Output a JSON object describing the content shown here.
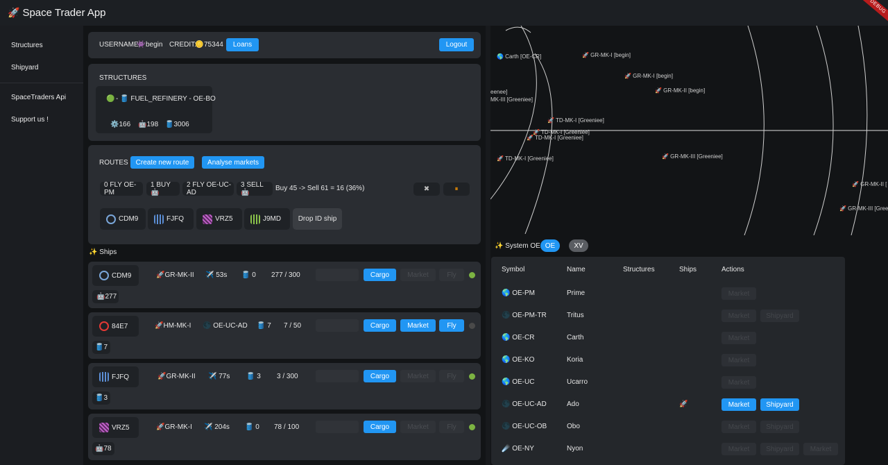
{
  "app": {
    "title": "Space Trader App",
    "debug": "DEBUG"
  },
  "sidebar": {
    "items": [
      "Structures",
      "Shipyard",
      "SpaceTraders Api",
      "Support us !"
    ]
  },
  "header": {
    "username_label": "USERNAME:",
    "username_icon": "👾",
    "username": "begin",
    "credit_label": "CREDIT:",
    "credit_icon": "🪙",
    "credit": "75344",
    "loans": "Loans",
    "logout": "Logout"
  },
  "structures": {
    "title": "STRUCTURES",
    "item": {
      "status": "🟢",
      "name": "- 🛢️ FUEL_REFINERY - OE-BO",
      "stats": [
        "⚙️166",
        "🤖198",
        "🛢️3006"
      ]
    }
  },
  "routes": {
    "title": "ROUTES",
    "create": "Create new route",
    "analyse": "Analyse markets",
    "steps": [
      "0 FLY OE-PM",
      "1 BUY 🤖",
      "2 FLY OE-UC-AD",
      "3 SELL 🤖"
    ],
    "summary": "Buy 45 -> Sell 61 = 16 (36%)",
    "close_icon": "✖",
    "pause_icon": "⏸",
    "ships": [
      "CDM9",
      "FJFQ",
      "VRZ5",
      "J9MD"
    ],
    "drop": "Drop ID ship"
  },
  "ships_section": {
    "title": "✨ Ships"
  },
  "ships": [
    {
      "id": "CDM9",
      "model": "🚀GR-MK-II",
      "status": "✈️ 53s",
      "fuel": "🛢️ 0",
      "cargo": "277 / 300",
      "extra": "🤖277",
      "btns": [
        "Cargo"
      ],
      "dim": [
        "",
        "Market",
        "Fly"
      ],
      "dot": "#7cb342"
    },
    {
      "id": "84E7",
      "model": "🚀HM-MK-I",
      "status": "🌑 OE-UC-AD",
      "fuel": "🛢️ 7",
      "cargo": "7 / 50",
      "extra": "🛢️7",
      "btns": [
        "Cargo",
        "Market",
        "Fly"
      ],
      "dim": [
        ""
      ],
      "dot": "#4a4a4a"
    },
    {
      "id": "FJFQ",
      "model": "🚀GR-MK-II",
      "status": "✈️ 77s",
      "fuel": "🛢️ 3",
      "cargo": "3 / 300",
      "extra": "🛢️3",
      "btns": [
        "Cargo"
      ],
      "dim": [
        "",
        "Market",
        "Fly"
      ],
      "dot": "#7cb342"
    },
    {
      "id": "VRZ5",
      "model": "🚀GR-MK-I",
      "status": "✈️ 204s",
      "fuel": "🛢️ 0",
      "cargo": "78 / 100",
      "extra": "🤖78",
      "btns": [
        "Cargo"
      ],
      "dim": [
        "",
        "Market",
        "Fly"
      ],
      "dot": "#7cb342"
    }
  ],
  "map": {
    "labels": [
      "🌎 Carth [OE-CR]",
      "🚀 GR-MK-I [begin]",
      "🚀 GR-MK-I [begin]",
      "🚀 GR-MK-II [begin]",
      "eenee]",
      "MK-III [Greeniee]",
      "🚀 TD-MK-I [Greeniee]",
      "🚀 TD-MK-I [Greeniee]",
      "🚀 TD-MK-I [Greeniee]",
      "🚀 TD-MK-I [Greeniee]",
      "🚀 GR-MK-III [Greeniee]",
      "🚀 GR-MK-II [",
      "🚀 GR-MK-III [Gree"
    ]
  },
  "system": {
    "title": "✨ System OE",
    "tabs": [
      "OE",
      "XV"
    ],
    "columns": [
      "Symbol",
      "Name",
      "Structures",
      "Ships",
      "Actions"
    ],
    "rows": [
      {
        "symbol": "🌎 OE-PM",
        "name": "Prime",
        "ships": "",
        "actions": [
          {
            "label": "Market",
            "on": false
          }
        ]
      },
      {
        "symbol": "🌑 OE-PM-TR",
        "name": "Tritus",
        "ships": "",
        "actions": [
          {
            "label": "Market",
            "on": false
          },
          {
            "label": "Shipyard",
            "on": false
          }
        ]
      },
      {
        "symbol": "🌎 OE-CR",
        "name": "Carth",
        "ships": "",
        "actions": [
          {
            "label": "Market",
            "on": false
          }
        ]
      },
      {
        "symbol": "🌎 OE-KO",
        "name": "Koria",
        "ships": "",
        "actions": [
          {
            "label": "Market",
            "on": false
          }
        ]
      },
      {
        "symbol": "🌎 OE-UC",
        "name": "Ucarro",
        "ships": "",
        "actions": [
          {
            "label": "Market",
            "on": false
          }
        ]
      },
      {
        "symbol": "🌑 OE-UC-AD",
        "name": "Ado",
        "ships": "🚀",
        "actions": [
          {
            "label": "Market",
            "on": true
          },
          {
            "label": "Shipyard",
            "on": true
          }
        ]
      },
      {
        "symbol": "🌑 OE-UC-OB",
        "name": "Obo",
        "ships": "",
        "actions": [
          {
            "label": "Market",
            "on": false
          },
          {
            "label": "Shipyard",
            "on": false
          }
        ]
      },
      {
        "symbol": "☄️ OE-NY",
        "name": "Nyon",
        "ships": "",
        "actions": [
          {
            "label": "Market",
            "on": false
          },
          {
            "label": "Shipyard",
            "on": false
          },
          {
            "label": "Market",
            "on": false
          }
        ]
      }
    ]
  },
  "colors": {
    "accent": "#2196f3",
    "card": "#2a2d32",
    "bg": "#121416",
    "online": "#7cb342"
  }
}
